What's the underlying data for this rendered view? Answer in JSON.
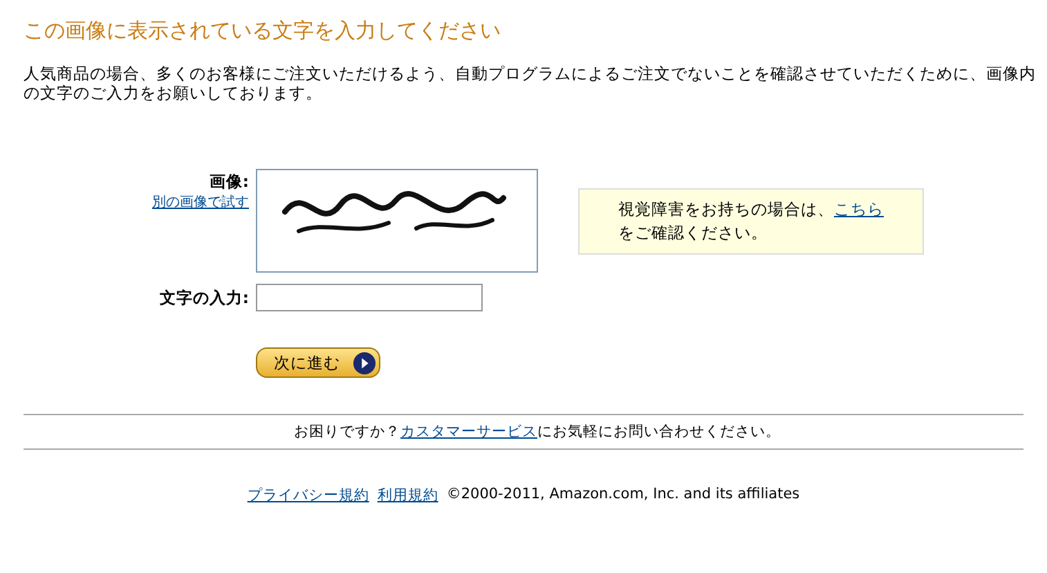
{
  "title": "この画像に表示されている文字を入力してください",
  "intro": "人気商品の場合、多くのお客様にご注文いただけるよう、自動プログラムによるご注文でないことを確認させていただくために、画像内の文字のご入力をお願いしております。",
  "captcha": {
    "label": "画像:",
    "retry_link": "別の画像で試す"
  },
  "input": {
    "label": "文字の入力:"
  },
  "submit_button": "次に進む",
  "accessibility_notice": {
    "before": "視覚障害をお持ちの場合は、",
    "link": "こちら",
    "after": "をご確認ください。"
  },
  "help": {
    "before": "お困りですか？",
    "link": "カスタマーサービス",
    "after": "にお気軽にお問い合わせください。"
  },
  "footer": {
    "links": [
      "プライバシー規約",
      "利用規約"
    ],
    "copyright": "©2000-2011, Amazon.com, Inc. and its affiliates"
  }
}
